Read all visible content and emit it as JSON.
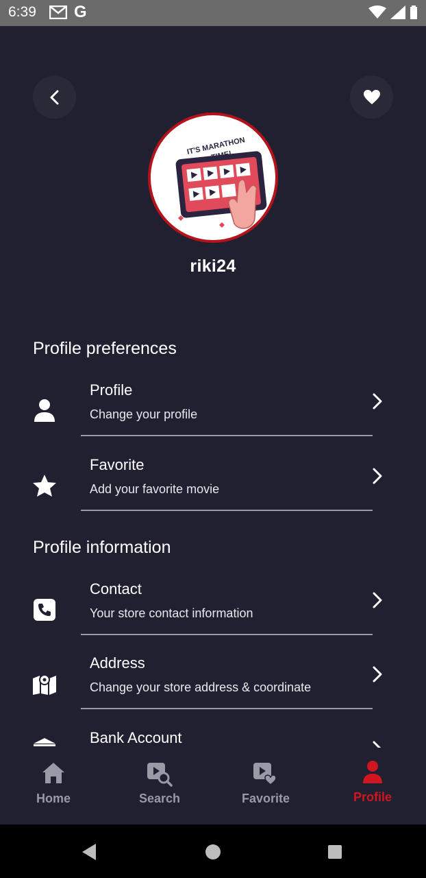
{
  "status_bar": {
    "time": "6:39",
    "g_label": "G"
  },
  "header": {
    "back_icon": "chevron-left-icon",
    "favorite_icon": "heart-icon"
  },
  "profile": {
    "username": "riki24",
    "avatar_text_1": "IT'S MARATHON",
    "avatar_text_2": "TIME!"
  },
  "sections": [
    {
      "title": "Profile preferences",
      "items": [
        {
          "icon": "person-icon",
          "title": "Profile",
          "subtitle": "Change your profile"
        },
        {
          "icon": "star-icon",
          "title": "Favorite",
          "subtitle": "Add your favorite movie"
        }
      ]
    },
    {
      "title": "Profile information",
      "items": [
        {
          "icon": "phone-icon",
          "title": "Contact",
          "subtitle": "Your store contact information"
        },
        {
          "icon": "map-icon",
          "title": "Address",
          "subtitle": "Change your store address & coordinate"
        },
        {
          "icon": "bank-icon",
          "title": "Bank Account",
          "subtitle": ""
        }
      ]
    }
  ],
  "bottom_nav": [
    {
      "label": "Home",
      "icon": "home-icon",
      "active": false
    },
    {
      "label": "Search",
      "icon": "video-search-icon",
      "active": false
    },
    {
      "label": "Favorite",
      "icon": "video-heart-icon",
      "active": false
    },
    {
      "label": "Profile",
      "icon": "person-icon",
      "active": true
    }
  ],
  "colors": {
    "background": "#212030",
    "accent": "#d0161f",
    "inactive": "#9a99a6"
  }
}
